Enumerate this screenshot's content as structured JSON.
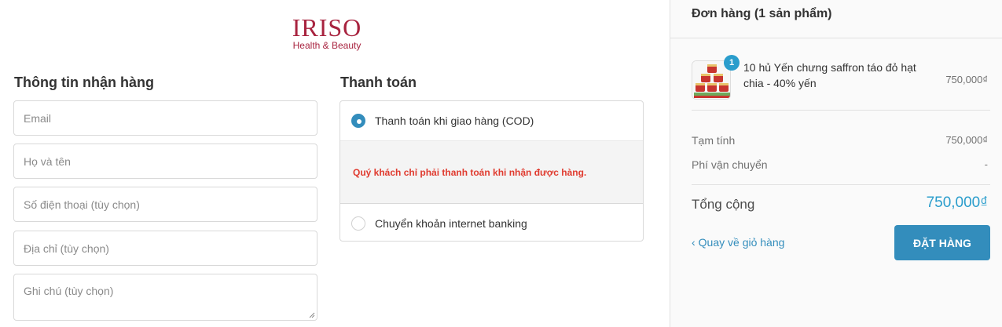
{
  "brand": {
    "logo_text": "IRISO",
    "logo_sub": "Health & Beauty",
    "color": "#a8233f"
  },
  "shipping": {
    "title": "Thông tin nhận hàng",
    "fields": {
      "email": "Email",
      "name": "Họ và tên",
      "phone": "Số điện thoại (tùy chọn)",
      "address": "Địa chỉ (tùy chọn)",
      "note": "Ghi chú (tùy chọn)"
    }
  },
  "payment": {
    "title": "Thanh toán",
    "options": [
      {
        "label": "Thanh toán khi giao hàng (COD)",
        "selected": true
      },
      {
        "label": "Chuyển khoản internet banking",
        "selected": false
      }
    ],
    "cod_note": "Quý khách chỉ phải thanh toán khi nhận được hàng."
  },
  "order": {
    "title": "Đơn hàng (1 sản phẩm)",
    "item": {
      "quantity": "1",
      "name": "10 hủ Yến chưng saffron táo đỏ hạt chia - 40% yến",
      "price": "750,000₫"
    },
    "subtotal_label": "Tạm tính",
    "subtotal_value": "750,000₫",
    "shipping_label": "Phí vận chuyển",
    "shipping_value": "-",
    "total_label": "Tổng cộng",
    "total_value": "750,000₫",
    "back_link": "Quay về giỏ hàng",
    "submit_label": "ĐẶT HÀNG"
  },
  "colors": {
    "accent": "#338dbc",
    "badge": "#2a9dcc",
    "error": "#e03b2f"
  }
}
